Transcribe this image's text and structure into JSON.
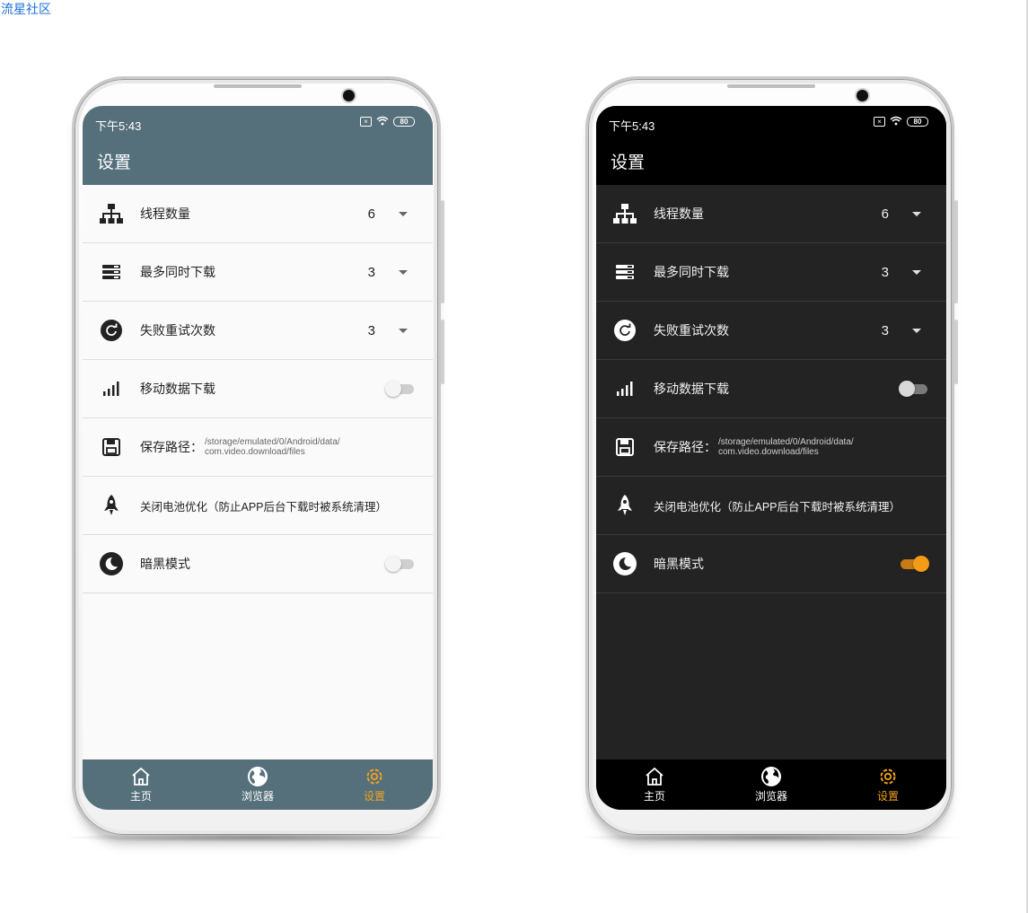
{
  "site": {
    "link_text": "流星社区"
  },
  "theme": {
    "accent": "#f29b16",
    "light_bar": "#56707b",
    "dark_bar": "#000000"
  },
  "light_phone": {
    "status": {
      "time": "下午5:43",
      "battery": "80"
    },
    "title": "设置",
    "settings": {
      "threads": {
        "label": "线程数量",
        "value": "6",
        "icon": "sitemap-icon"
      },
      "max_downloads": {
        "label": "最多同时下载",
        "value": "3",
        "icon": "stack-icon"
      },
      "retry": {
        "label": "失败重试次数",
        "value": "3",
        "icon": "refresh-icon"
      },
      "mobile_data": {
        "label": "移动数据下载",
        "enabled": false,
        "icon": "signal-icon"
      },
      "save_path": {
        "label": "保存路径：",
        "line1": "/storage/emulated/0/Android/data/",
        "line2": "com.video.download/files",
        "icon": "save-icon"
      },
      "battery_opt": {
        "label": "关闭电池优化（防止APP后台下载时被系统清理）",
        "icon": "rocket-icon"
      },
      "dark_mode": {
        "label": "暗黑模式",
        "enabled": false,
        "icon": "moon-icon"
      }
    },
    "nav": [
      {
        "label": "主页",
        "icon": "home-icon",
        "active": false
      },
      {
        "label": "浏览器",
        "icon": "globe-icon",
        "active": false
      },
      {
        "label": "设置",
        "icon": "gear-icon",
        "active": true
      }
    ]
  },
  "dark_phone": {
    "status": {
      "time": "下午5:43",
      "battery": "80"
    },
    "title": "设置",
    "settings": {
      "threads": {
        "label": "线程数量",
        "value": "6",
        "icon": "sitemap-icon"
      },
      "max_downloads": {
        "label": "最多同时下载",
        "value": "3",
        "icon": "stack-icon"
      },
      "retry": {
        "label": "失败重试次数",
        "value": "3",
        "icon": "refresh-icon"
      },
      "mobile_data": {
        "label": "移动数据下载",
        "enabled": false,
        "icon": "signal-icon"
      },
      "save_path": {
        "label": "保存路径：",
        "line1": "/storage/emulated/0/Android/data/",
        "line2": "com.video.download/files",
        "icon": "save-icon"
      },
      "battery_opt": {
        "label": "关闭电池优化（防止APP后台下载时被系统清理）",
        "icon": "rocket-icon"
      },
      "dark_mode": {
        "label": "暗黑模式",
        "enabled": true,
        "icon": "moon-icon"
      }
    },
    "nav": [
      {
        "label": "主页",
        "icon": "home-icon",
        "active": false
      },
      {
        "label": "浏览器",
        "icon": "globe-icon",
        "active": false
      },
      {
        "label": "设置",
        "icon": "gear-icon",
        "active": true
      }
    ]
  }
}
